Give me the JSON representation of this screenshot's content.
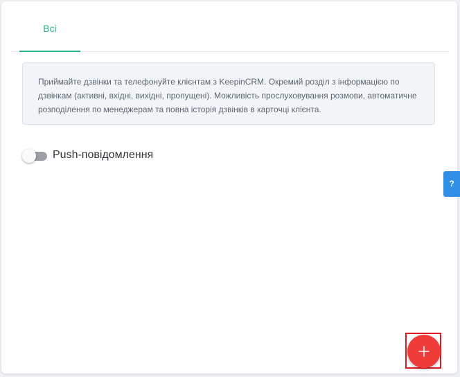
{
  "tabs": [
    {
      "label": "Всі",
      "active": true
    }
  ],
  "info": {
    "text": "Приймайте дзвінки та телефонуйте клієнтам з KeepinCRM. Окремий розділ з інформацією по дзвінкам (активні, вхідні, вихідні, пропущені). Можливість прослуховування розмови, автоматичне розподілення по менеджерам та повна історія дзвінків в карточці клієнта."
  },
  "push_toggle": {
    "label": "Push-повідомлення",
    "enabled": false
  },
  "help": {
    "label": "?"
  },
  "fab": {
    "icon": "plus-icon",
    "highlighted": true
  },
  "colors": {
    "accent": "#2bb58d",
    "fab": "#f03c38",
    "help": "#2f8fe6",
    "highlight": "#e0191e"
  }
}
